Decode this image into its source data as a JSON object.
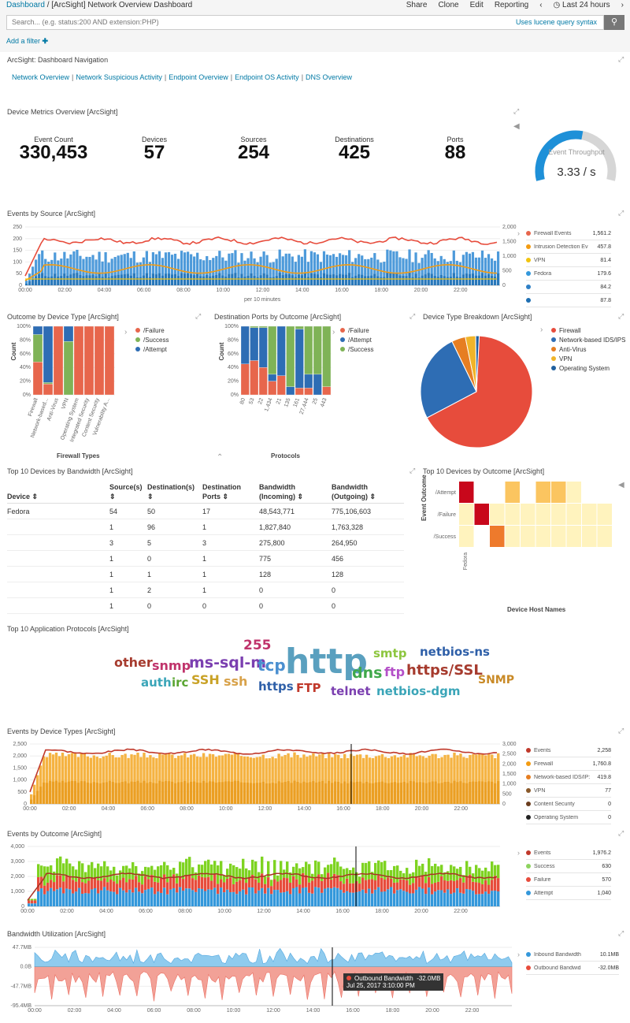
{
  "topbar": {
    "breadcrumb_root": "Dashboard",
    "breadcrumb_sep": "/",
    "title": "[ArcSight] Network Overview Dashboard",
    "share": "Share",
    "clone": "Clone",
    "edit": "Edit",
    "reporting": "Reporting",
    "time": "Last 24 hours"
  },
  "search": {
    "placeholder": "Search... (e.g. status:200 AND extension:PHP)",
    "lucene": "Uses lucene query syntax",
    "add_filter": "Add a filter"
  },
  "nav": {
    "title": "ArcSight: Dashboard Navigation",
    "links": [
      "Network Overview",
      "Network Suspicious Activity",
      "Endpoint Overview",
      "Endpoint OS Activity",
      "DNS Overview"
    ]
  },
  "metrics": {
    "title": "Device Metrics Overview [ArcSight]",
    "items": [
      {
        "label": "Event Count",
        "value": "330,453"
      },
      {
        "label": "Devices",
        "value": "57"
      },
      {
        "label": "Sources",
        "value": "254"
      },
      {
        "label": "Destinations",
        "value": "425"
      },
      {
        "label": "Ports",
        "value": "88"
      }
    ],
    "gauge_label": "Event Throughput",
    "gauge_value": "3.33 / s",
    "gauge_fraction": 0.55
  },
  "events_by_source": {
    "title": "Events by Source [ArcSight]",
    "xlabel": "per 10 minutes",
    "y_ticks": [
      "250",
      "200",
      "150",
      "100",
      "50",
      "0"
    ],
    "y2_ticks": [
      "2,000",
      "1,500",
      "1,000",
      "500",
      "0"
    ],
    "x_ticks": [
      "00:00",
      "02:00",
      "04:00",
      "06:00",
      "08:00",
      "10:00",
      "12:00",
      "14:00",
      "16:00",
      "18:00",
      "20:00",
      "22:00"
    ],
    "legend": [
      {
        "name": "Firewall Events",
        "value": "1,561.2",
        "color": "#e7664c"
      },
      {
        "name": "Intrusion Detection Ev",
        "value": "457.8",
        "color": "#f39c12"
      },
      {
        "name": "VPN",
        "value": "81.4",
        "color": "#f1c40f"
      },
      {
        "name": "Fedora",
        "value": "179.6",
        "color": "#3498db"
      },
      {
        "name": "",
        "value": "84.2",
        "color": "#2f80c6"
      },
      {
        "name": "",
        "value": "87.8",
        "color": "#1f6fb2"
      }
    ]
  },
  "outcome_device": {
    "title": "Outcome by Device Type [ArcSight]",
    "ylabel": "Count",
    "xlabel": "Firewall Types",
    "y_ticks": [
      "100%",
      "80%",
      "60%",
      "40%",
      "20%",
      "0%"
    ],
    "legend": [
      {
        "name": "/Failure",
        "color": "#e7664c"
      },
      {
        "name": "/Success",
        "color": "#7fb357"
      },
      {
        "name": "/Attempt",
        "color": "#2e6db4"
      }
    ],
    "categories": [
      "Firewall",
      "Network-based...",
      "Anti-Virus",
      "VPN",
      "Operating System",
      "Integrated Security",
      "Content Security",
      "Vulnerability A..."
    ]
  },
  "dest_ports": {
    "title": "Destination Ports by Outcome [ArcSight]",
    "ylabel": "Count",
    "xlabel": "Protocols",
    "y_ticks": [
      "100%",
      "80%",
      "60%",
      "40%",
      "20%",
      "0%"
    ],
    "legend": [
      {
        "name": "/Failure",
        "color": "#e7664c"
      },
      {
        "name": "/Attempt",
        "color": "#2e6db4"
      },
      {
        "name": "/Success",
        "color": "#7fb357"
      }
    ],
    "categories": [
      "80",
      "53",
      "22",
      "1,434",
      "21",
      "135",
      "161",
      "27,444",
      "25",
      "443"
    ]
  },
  "device_breakdown": {
    "title": "Device Type Breakdown [ArcSight]",
    "legend": [
      {
        "name": "Firewall",
        "color": "#e74c3c"
      },
      {
        "name": "Network-based IDS/IPS",
        "color": "#2e6db4"
      },
      {
        "name": "Anti-Virus",
        "color": "#e67e22"
      },
      {
        "name": "VPN",
        "color": "#f0b429"
      },
      {
        "name": "Operating System",
        "color": "#1f5f9e"
      }
    ],
    "slices": [
      0.665,
      0.255,
      0.04,
      0.03,
      0.01
    ]
  },
  "top_bandwidth": {
    "title": "Top 10 Devices by Bandwidth [ArcSight]",
    "columns": [
      "Device",
      "Source(s)",
      "Destination(s)",
      "Destination Ports",
      "Bandwidth (Incoming)",
      "Bandwidth (Outgoing)"
    ],
    "rows": [
      [
        "Fedora",
        "54",
        "50",
        "17",
        "48,543,771",
        "775,106,603"
      ],
      [
        "",
        "1",
        "96",
        "1",
        "1,827,840",
        "1,763,328"
      ],
      [
        "",
        "3",
        "5",
        "3",
        "275,800",
        "264,950"
      ],
      [
        "",
        "1",
        "0",
        "1",
        "775",
        "456"
      ],
      [
        "",
        "1",
        "1",
        "1",
        "128",
        "128"
      ],
      [
        "",
        "1",
        "2",
        "1",
        "0",
        "0"
      ],
      [
        "",
        "1",
        "0",
        "0",
        "0",
        "0"
      ]
    ]
  },
  "top_outcome": {
    "title": "Top 10 Devices by Outcome [ArcSight]",
    "ylabel": "Event Outcome",
    "xlabel": "Device Host Names",
    "rows": [
      "/Attempt",
      "/Failure",
      "/Success"
    ],
    "x_label0": "Fedora"
  },
  "protocols": {
    "title": "Top 10 Application Protocols [ArcSight]",
    "words": [
      {
        "t": "255",
        "c": "#c0336b"
      },
      {
        "t": "other",
        "c": "#a63b2e"
      },
      {
        "t": "snmp",
        "c": "#c0336b"
      },
      {
        "t": "ms-sql-m",
        "c": "#7b3fb0"
      },
      {
        "t": "tcp",
        "c": "#4a8fd0"
      },
      {
        "t": "http",
        "c": "#5aa0bf"
      },
      {
        "t": "smtp",
        "c": "#8dc63f"
      },
      {
        "t": "netbios-ns",
        "c": "#2e5fa8"
      },
      {
        "t": "auth",
        "c": "#3aa5b8"
      },
      {
        "t": "irc",
        "c": "#5aa532"
      },
      {
        "t": "SSH",
        "c": "#c9a227"
      },
      {
        "t": "ssh",
        "c": "#d8a24a"
      },
      {
        "t": "https",
        "c": "#2e5fa8"
      },
      {
        "t": "FTP",
        "c": "#c0392b"
      },
      {
        "t": "dns",
        "c": "#3fa84a"
      },
      {
        "t": "ftp",
        "c": "#b450c8"
      },
      {
        "t": "https/SSL",
        "c": "#a63b2e"
      },
      {
        "t": "SNMP",
        "c": "#c98a27"
      },
      {
        "t": "telnet",
        "c": "#7b3fb0"
      },
      {
        "t": "netbios-dgm",
        "c": "#3aa5b8"
      }
    ]
  },
  "events_device_types": {
    "title": "Events by Device Types [ArcSight]",
    "y_ticks": [
      "2,500",
      "2,000",
      "1,500",
      "1,000",
      "500",
      "0"
    ],
    "y2_ticks": [
      "3,000",
      "2,500",
      "2,000",
      "1,500",
      "1,000",
      "500",
      "0"
    ],
    "x_ticks": [
      "00:00",
      "02:00",
      "04:00",
      "06:00",
      "08:00",
      "10:00",
      "12:00",
      "14:00",
      "16:00",
      "18:00",
      "20:00",
      "22:00"
    ],
    "legend": [
      {
        "name": "Events",
        "value": "2,258",
        "color": "#c0392b"
      },
      {
        "name": "Firewall",
        "value": "1,760.8",
        "color": "#f39c12"
      },
      {
        "name": "Network-based IDS/IP:",
        "value": "419.8",
        "color": "#e67e22"
      },
      {
        "name": "VPN",
        "value": "77",
        "color": "#8a5a2b"
      },
      {
        "name": "Content Security",
        "value": "0",
        "color": "#6b3d1e"
      },
      {
        "name": "Operating System",
        "value": "0",
        "color": "#222222"
      }
    ]
  },
  "events_outcome": {
    "title": "Events by Outcome [ArcSight]",
    "y_ticks": [
      "4,000",
      "3,000",
      "2,000",
      "1,000",
      "0"
    ],
    "x_ticks": [
      "00:00",
      "02:00",
      "04:00",
      "06:00",
      "08:00",
      "10:00",
      "12:00",
      "14:00",
      "16:00",
      "18:00",
      "20:00",
      "22:00"
    ],
    "legend": [
      {
        "name": "Events",
        "value": "1,976.2",
        "color": "#c0392b"
      },
      {
        "name": "Success",
        "value": "630",
        "color": "#8dd35f"
      },
      {
        "name": "Failure",
        "value": "570",
        "color": "#e74c3c"
      },
      {
        "name": "Attempt",
        "value": "1,040",
        "color": "#3498db"
      }
    ]
  },
  "bandwidth": {
    "title": "Bandwidth Utilization [ArcSight]",
    "y_ticks": [
      "47.7MB",
      "0.0B",
      "-47.7MB",
      "-95.4MB"
    ],
    "x_ticks": [
      "00:00",
      "02:00",
      "04:00",
      "06:00",
      "08:00",
      "10:00",
      "12:00",
      "14:00",
      "16:00",
      "18:00",
      "20:00",
      "22:00"
    ],
    "legend": [
      {
        "name": "Inbound Bandwidth",
        "value": "10.1MB",
        "color": "#3498db"
      },
      {
        "name": "Outbound Bandwid",
        "value": "-32.0MB",
        "color": "#e74c3c"
      }
    ],
    "tooltip": {
      "label": "Outbound Bandwidth",
      "value": "-32.0MB",
      "time": "Jul 25, 2017 3:10:00 PM"
    }
  }
}
